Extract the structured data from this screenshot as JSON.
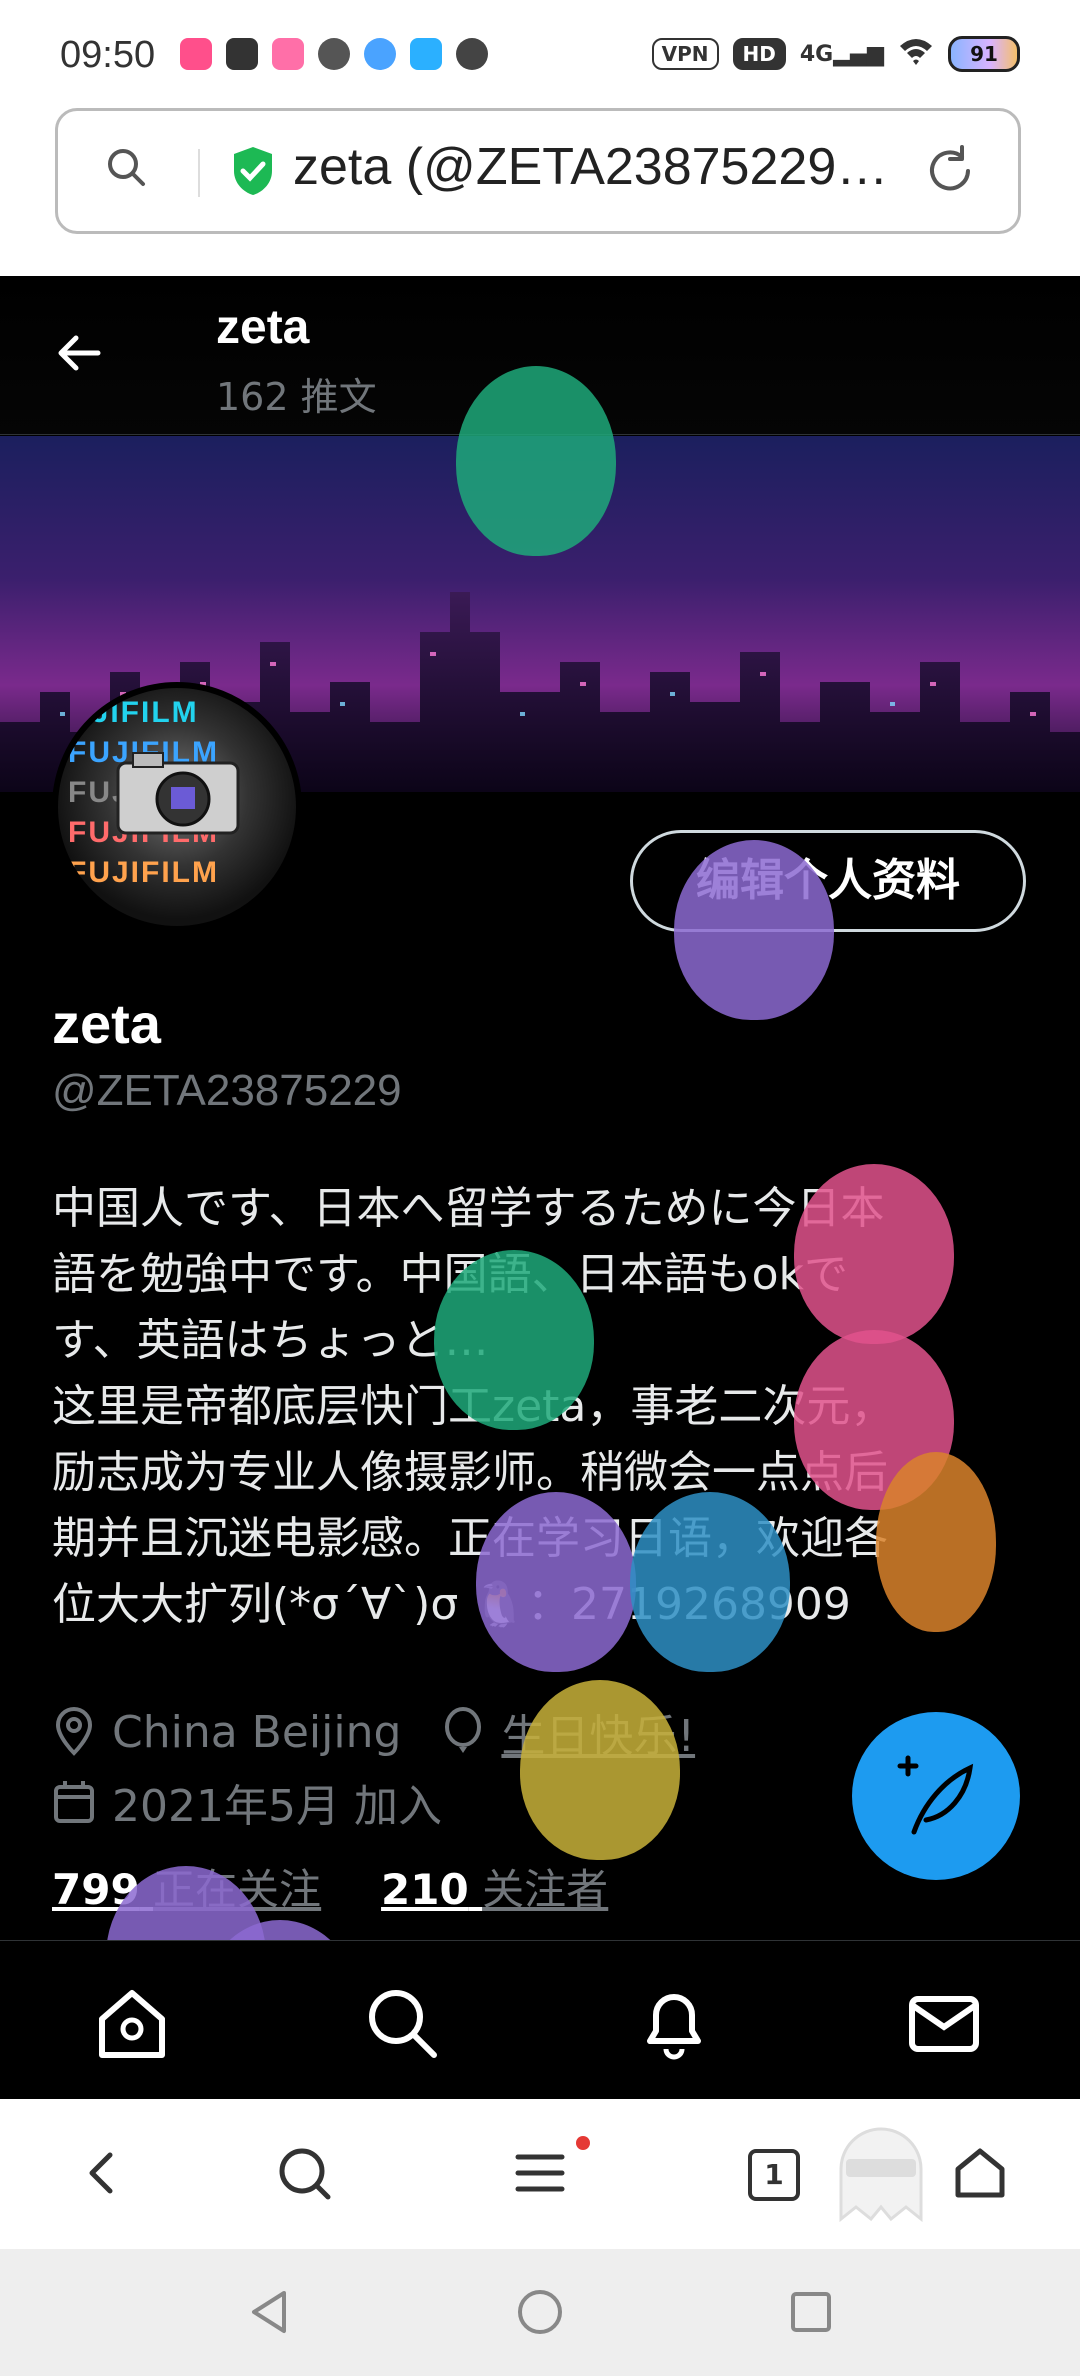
{
  "status_bar": {
    "time": "09:50",
    "vpn": "VPN",
    "hd": "HD",
    "network": "4G",
    "battery": "91"
  },
  "address_bar": {
    "url": "zeta (@ZETA23875229…"
  },
  "profile": {
    "header_name": "zeta",
    "header_tweets": "162 推文",
    "name": "zeta",
    "handle": "@ZETA23875229",
    "edit_button": "编辑个人资料",
    "bio": "中国人です、日本へ留学するために今日本\n語を勉強中です。中国語、日本語もokで\nす、英語はちょっと…\n这里是帝都底层快门工zeta，事老二次元，\n励志成为专业人像摄影师。稍微会一点点后\n期并且沉迷电影感。正在学习日语，欢迎各\n位大大扩列(*σ´∀`)σ 🐧：2719268909",
    "location": "China Beijing",
    "birthday": "生日快乐!",
    "joined": "2021年5月 加入",
    "following_count": "799",
    "following_label": "正在关注",
    "followers_count": "210",
    "followers_label": "关注者",
    "avatar_text": [
      "UJIFILM",
      "FUJIFILM",
      "FUJIFILM",
      "FUJIFILM",
      "FUJIFILM"
    ]
  },
  "colors": {
    "background": "#000000",
    "accent": "#1d9bf0",
    "muted": "#71767b",
    "balloon_purple": "#8c6ad1",
    "balloon_green": "#1fa97a",
    "balloon_pink": "#e0528c",
    "balloon_orange": "#d9822b",
    "balloon_blue": "#2e8fc4",
    "balloon_yellow": "#c8b23a"
  },
  "icons": {
    "tabbar": [
      "home-icon",
      "search-icon",
      "bell-icon",
      "mail-icon"
    ],
    "browserbar": [
      "back-icon",
      "search-icon",
      "menu-icon",
      "tabs-icon",
      "home-icon"
    ],
    "tabs_count": "1"
  }
}
